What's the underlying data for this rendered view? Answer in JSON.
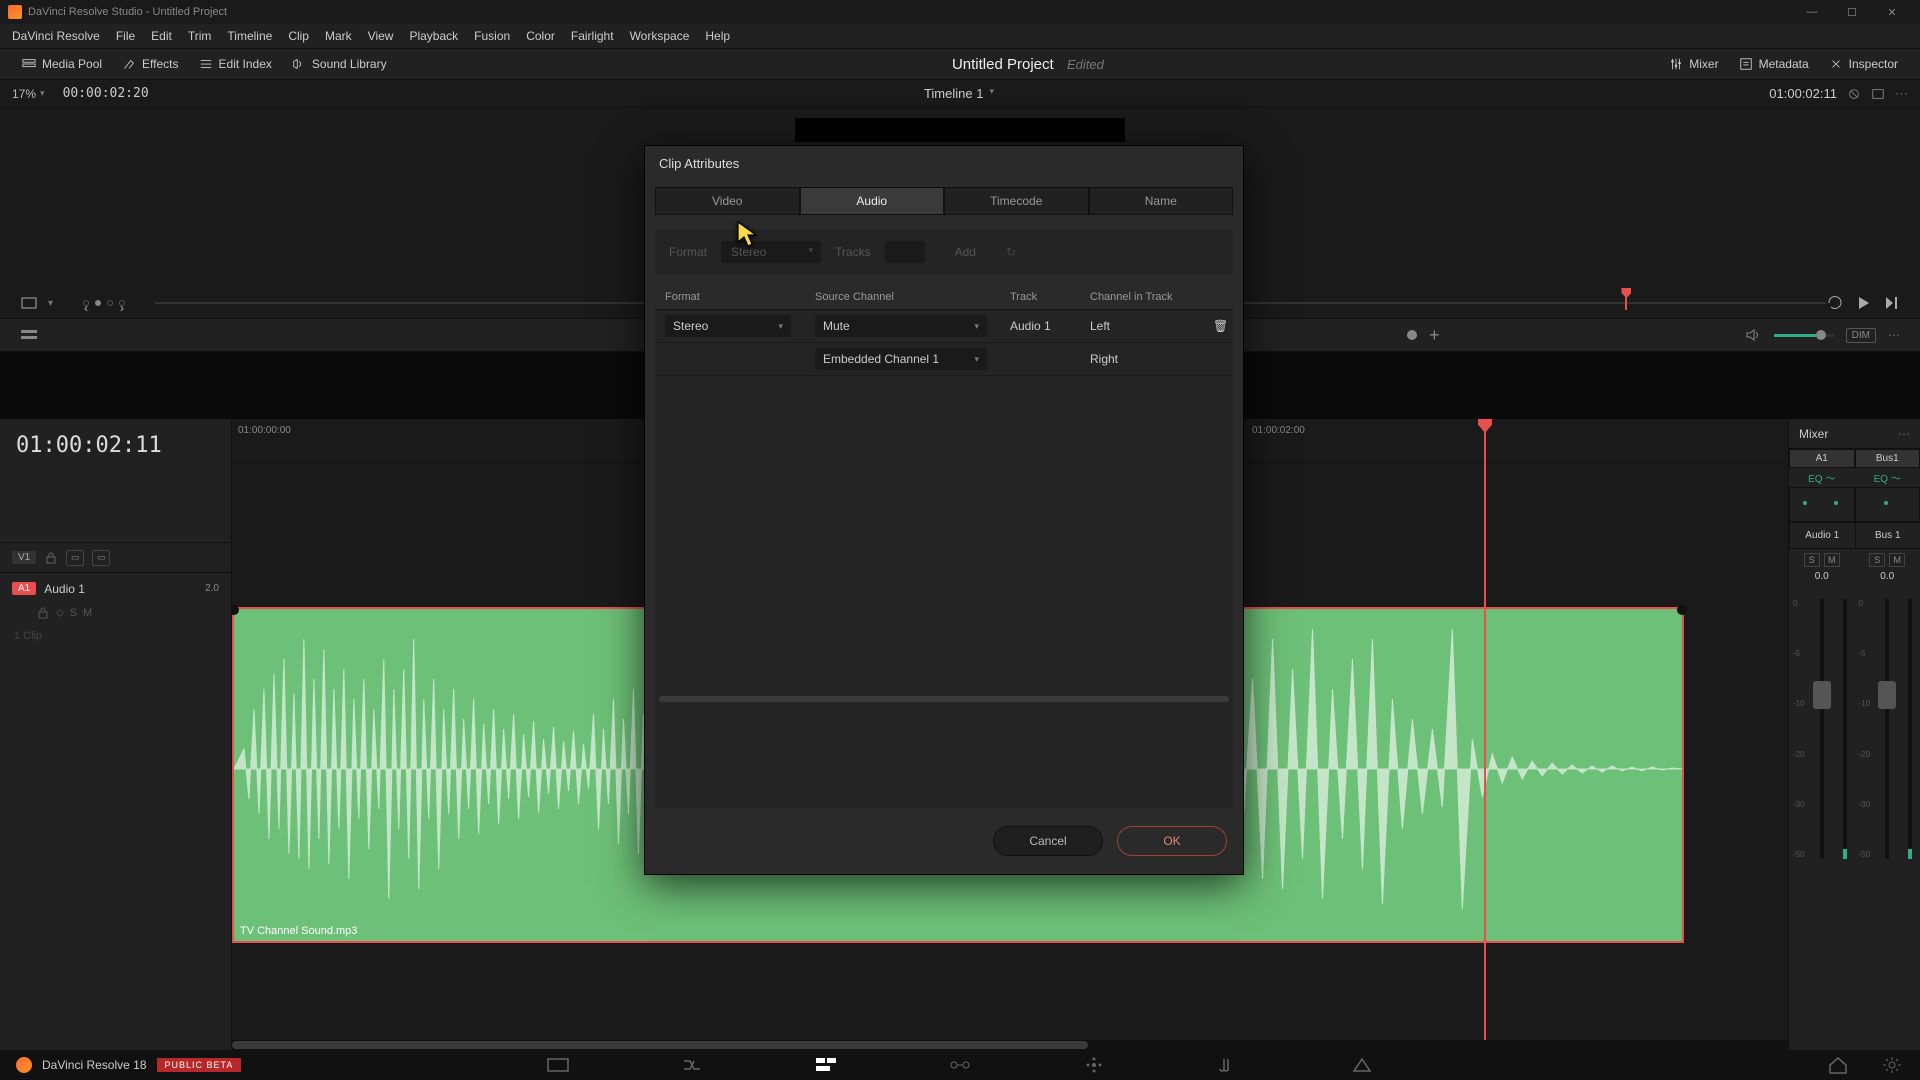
{
  "window_title": "DaVinci Resolve Studio - Untitled Project",
  "menus": [
    "DaVinci Resolve",
    "File",
    "Edit",
    "Trim",
    "Timeline",
    "Clip",
    "Mark",
    "View",
    "Playback",
    "Fusion",
    "Color",
    "Fairlight",
    "Workspace",
    "Help"
  ],
  "toolbar": {
    "media_pool": "Media Pool",
    "effects": "Effects",
    "edit_index": "Edit Index",
    "sound_library": "Sound Library",
    "mixer": "Mixer",
    "metadata": "Metadata",
    "inspector": "Inspector"
  },
  "project": {
    "title": "Untitled Project",
    "status": "Edited"
  },
  "viewer": {
    "zoom": "17%",
    "left_tc": "00:00:02:20",
    "timeline_name": "Timeline 1",
    "right_tc": "01:00:02:11"
  },
  "big_tc": "01:00:02:11",
  "ruler": {
    "t0": "01:00:00:00",
    "t1": "01:00:02:00"
  },
  "tracks": {
    "v1": "V1",
    "a1_tag": "A1",
    "a1_name": "Audio 1",
    "a1_ch": "2.0",
    "s": "S",
    "m": "M",
    "clip_info": "1 Clip"
  },
  "clip_name": "TV Channel Sound.mp3",
  "mixer": {
    "title": "Mixer",
    "ch1": "A1",
    "ch2": "Bus1",
    "eq": "EQ",
    "trk1": "Audio 1",
    "trk2": "Bus 1",
    "s": "S",
    "m": "M",
    "db": "0.0",
    "ticks": [
      "0",
      "-5",
      "-10",
      "-20",
      "-30",
      "-50"
    ]
  },
  "dialog": {
    "title": "Clip Attributes",
    "tabs": [
      "Video",
      "Audio",
      "Timecode",
      "Name"
    ],
    "active_tab": 1,
    "addrow": {
      "format_label": "Format",
      "format_value": "Stereo",
      "tracks_label": "Tracks",
      "add": "Add"
    },
    "cols": {
      "format": "Format",
      "source": "Source Channel",
      "track": "Track",
      "cit": "Channel in Track"
    },
    "rows": [
      {
        "format": "Stereo",
        "source": "Mute",
        "track": "Audio 1",
        "cit": "Left"
      },
      {
        "format": "",
        "source": "Embedded Channel 1",
        "track": "",
        "cit": "Right"
      }
    ],
    "cancel": "Cancel",
    "ok": "OK"
  },
  "footer": {
    "app": "DaVinci Resolve 18",
    "beta": "PUBLIC BETA"
  }
}
